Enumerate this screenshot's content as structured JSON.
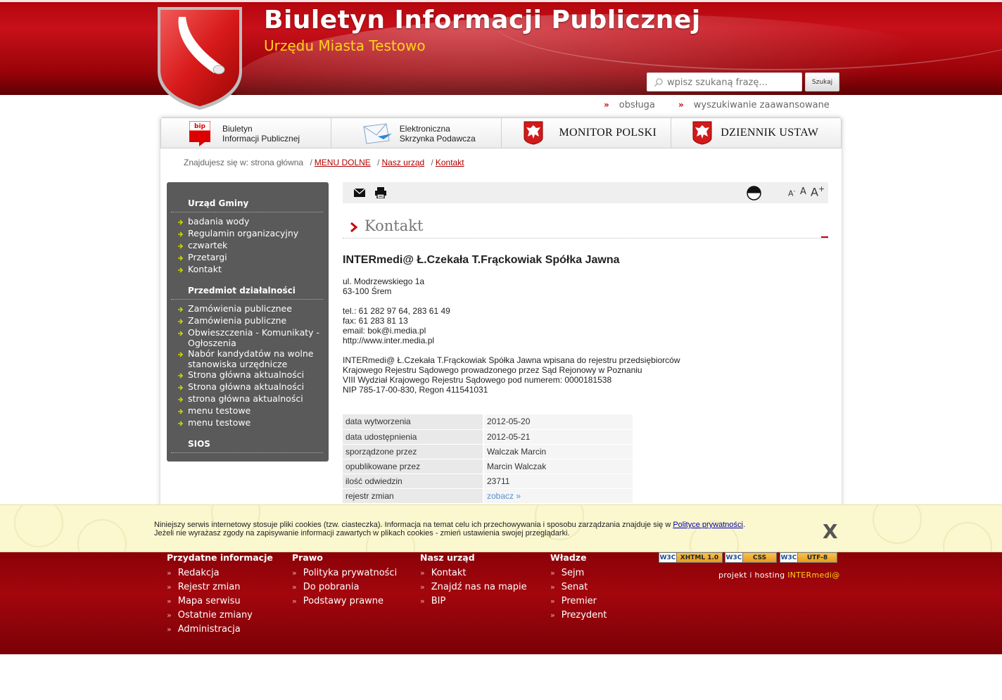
{
  "header": {
    "title": "Biuletyn Informacji Publicznej",
    "subtitle": "Urzędu Miasta Testowo",
    "search": {
      "placeholder": "wpisz szukaną frazę...",
      "button_label": "Szukaj"
    }
  },
  "util_links": [
    "obsługa",
    "wyszukiwanie zaawansowane"
  ],
  "tabs": [
    {
      "line1": "Biuletyn",
      "line2": "Informacji Publicznej",
      "icon": "bip-logo-icon"
    },
    {
      "line1": "Elektroniczna",
      "line2": "Skrzynka Podawcza",
      "icon": "envelope-icon"
    },
    {
      "label": "MONITOR POLSKI",
      "icon": "eagle-emblem-icon"
    },
    {
      "label": "DZIENNIK USTAW",
      "icon": "eagle-emblem-icon"
    }
  ],
  "breadcrumb": {
    "prefix": "Znajdujesz się w: strona główna",
    "items": [
      "MENU DOLNE",
      "Nasz urząd",
      "Kontakt"
    ]
  },
  "sidebar": {
    "sections": [
      {
        "heading": "Urząd Gminy",
        "items": [
          "badania wody",
          "Regulamin organizacyjny",
          "czwartek",
          "Przetargi",
          "Kontakt"
        ]
      },
      {
        "heading": "Przedmiot działalności",
        "items": [
          "Zamówienia publicznee",
          "Zamówienia publiczne",
          "Obwieszczenia - Komunikaty - Ogłoszenia",
          "Nabór kandydatów na wolne stanowiska urzędnicze",
          "Strona główna aktualności",
          "Strona główna aktualności",
          "strona główna aktualności",
          "menu testowe",
          "menu testowe"
        ]
      },
      {
        "heading": "SIOS",
        "items": []
      }
    ]
  },
  "toolbar": {
    "font_small": "A",
    "font_mid": "A",
    "font_big": "A",
    "minus": "-",
    "plus": "+"
  },
  "content": {
    "title": "Kontakt",
    "company": "INTERmedi@ Ł.Czekała T.Frąckowiak Spółka Jawna",
    "address": [
      "ul. Modrzewskiego  1a",
      "63-100 Śrem"
    ],
    "contact": [
      "tel.: 61 282 97 64, 283 61 49",
      "fax: 61 283 81 13",
      "email: bok@i.media.pl",
      "http://www.inter.media.pl"
    ],
    "registry": [
      "INTERmedi@ Ł.Czekała T.Frąckowiak Spółka Jawna wpisana do rejestru przedsiębiorców",
      "Krajowego Rejestru Sądowego prowadzonego przez Sąd Rejonowy w Poznaniu",
      "VIII Wydział Krajowego Rejestru Sądowego pod numerem: 0000181538",
      "NIP 785-17-00-830, Regon 411541031"
    ],
    "meta": [
      {
        "key": "data wytworzenia",
        "value": "2012-05-20"
      },
      {
        "key": "data udostępnienia",
        "value": "2012-05-21"
      },
      {
        "key": "sporządzone przez",
        "value": "Walczak Marcin"
      },
      {
        "key": "opublikowane przez",
        "value": "Marcin Walczak"
      },
      {
        "key": "ilość odwiedzin",
        "value": "23711"
      },
      {
        "key": "rejestr zmian",
        "value": "zobacz »"
      }
    ]
  },
  "cookie": {
    "line1": "Niniejszy serwis internetowy stosuje pliki cookies (tzw. ciasteczka). Informacja na temat celu ich przechowywania i sposobu zarządzania znajduje się w ",
    "link": "Polityce prywatności",
    "line1_end": ".",
    "line2": "Jeżeli nie wyrażasz zgody na zapisywanie informacji zawartych w plikach cookies - zmień ustawienia swojej przeglądarki.",
    "close": "X"
  },
  "footer": {
    "columns": [
      {
        "heading": "Przydatne informacje",
        "items": [
          "Redakcja",
          "Rejestr zmian",
          "Mapa serwisu",
          "Ostatnie zmiany",
          "Administracja"
        ]
      },
      {
        "heading": "Prawo",
        "items": [
          "Polityka prywatności",
          "Do pobrania",
          "Podstawy prawne"
        ]
      },
      {
        "heading": "Nasz urząd",
        "items": [
          "Kontakt",
          "Znajdź nas na mapie",
          "BIP"
        ]
      },
      {
        "heading": "Władze",
        "items": [
          "Sejm",
          "Senat",
          "Premier",
          "Prezydent"
        ]
      }
    ],
    "badges": [
      {
        "w3c": "W3C",
        "text": "XHTML 1.0"
      },
      {
        "w3c": "W3C",
        "text": "CSS"
      },
      {
        "w3c": "W3C",
        "text": "UTF-8"
      }
    ],
    "credits_prefix": "projekt i hosting ",
    "credits_brand": "INTERmedi@",
    "bullet": "»"
  },
  "colors": {
    "brand_red": "#b3050c",
    "accent_yellow": "#ffd21a",
    "sidebar_gray": "#5a5a5a",
    "cookie_bg": "#fbf7cf"
  }
}
